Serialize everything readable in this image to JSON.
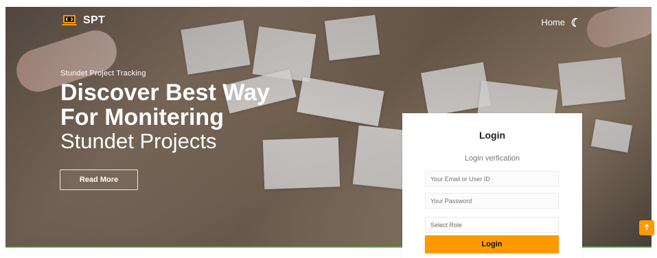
{
  "brand": {
    "name": "SPT",
    "icon": "laptop-code-icon"
  },
  "nav": {
    "home_label": "Home",
    "theme_icon": "moon-icon"
  },
  "hero": {
    "eyebrow": "Stundet Project Tracking",
    "headline_line1": "Discover Best Way",
    "headline_line2": "For Monitering",
    "headline_line3": "Stundet Projects",
    "read_more_label": "Read More"
  },
  "login": {
    "title": "Login",
    "subtitle": "Login verfication",
    "email_placeholder": "Your Email or User ID",
    "password_placeholder": "Your Password",
    "role_select": {
      "selected": "Select Role"
    },
    "button_label": "Login"
  },
  "ui": {
    "scroll_top_icon": "arrow-up-icon"
  },
  "colors": {
    "accent": "#ff9900",
    "underline": "#61c44a",
    "text_white": "#ffffff",
    "card_bg": "#ffffff"
  }
}
